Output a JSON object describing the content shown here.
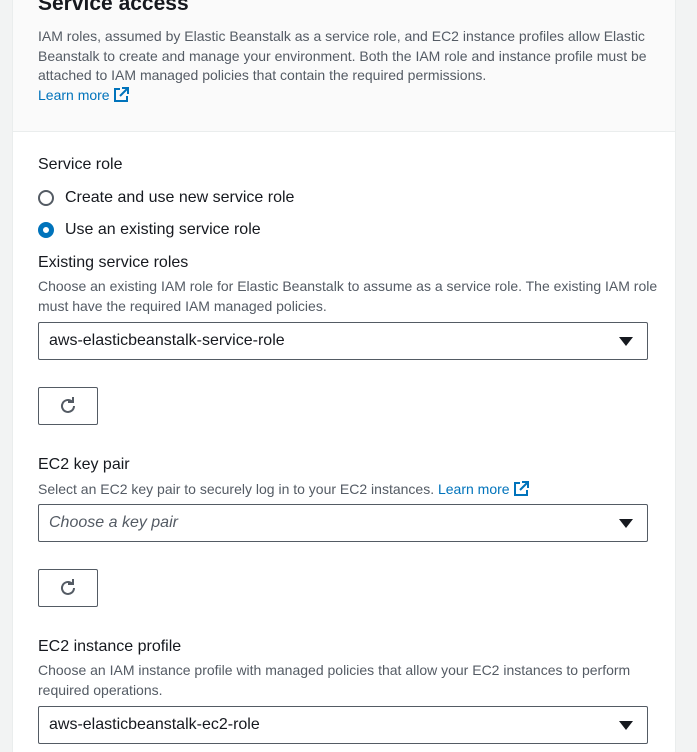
{
  "header": {
    "title": "Service access",
    "description": "IAM roles, assumed by Elastic Beanstalk as a service role, and EC2 instance profiles allow Elastic Beanstalk to create and manage your environment. Both the IAM role and instance profile must be attached to IAM managed policies that contain the required permissions.",
    "learn_more": "Learn more"
  },
  "service_role": {
    "label": "Service role",
    "options": [
      {
        "label": "Create and use new service role",
        "selected": false
      },
      {
        "label": "Use an existing service role",
        "selected": true
      }
    ]
  },
  "existing_roles": {
    "label": "Existing service roles",
    "description": "Choose an existing IAM role for Elastic Beanstalk to assume as a service role. The existing IAM role must have the required IAM managed policies.",
    "value": "aws-elasticbeanstalk-service-role"
  },
  "key_pair": {
    "label": "EC2 key pair",
    "description": "Select an EC2 key pair to securely log in to your EC2 instances.",
    "learn_more": "Learn more",
    "placeholder": "Choose a key pair"
  },
  "instance_profile": {
    "label": "EC2 instance profile",
    "description": "Choose an IAM instance profile with managed policies that allow your EC2 instances to perform required operations.",
    "value": "aws-elasticbeanstalk-ec2-role"
  },
  "colors": {
    "link": "#0073bb",
    "text": "#16191f",
    "secondary": "#545b64"
  }
}
